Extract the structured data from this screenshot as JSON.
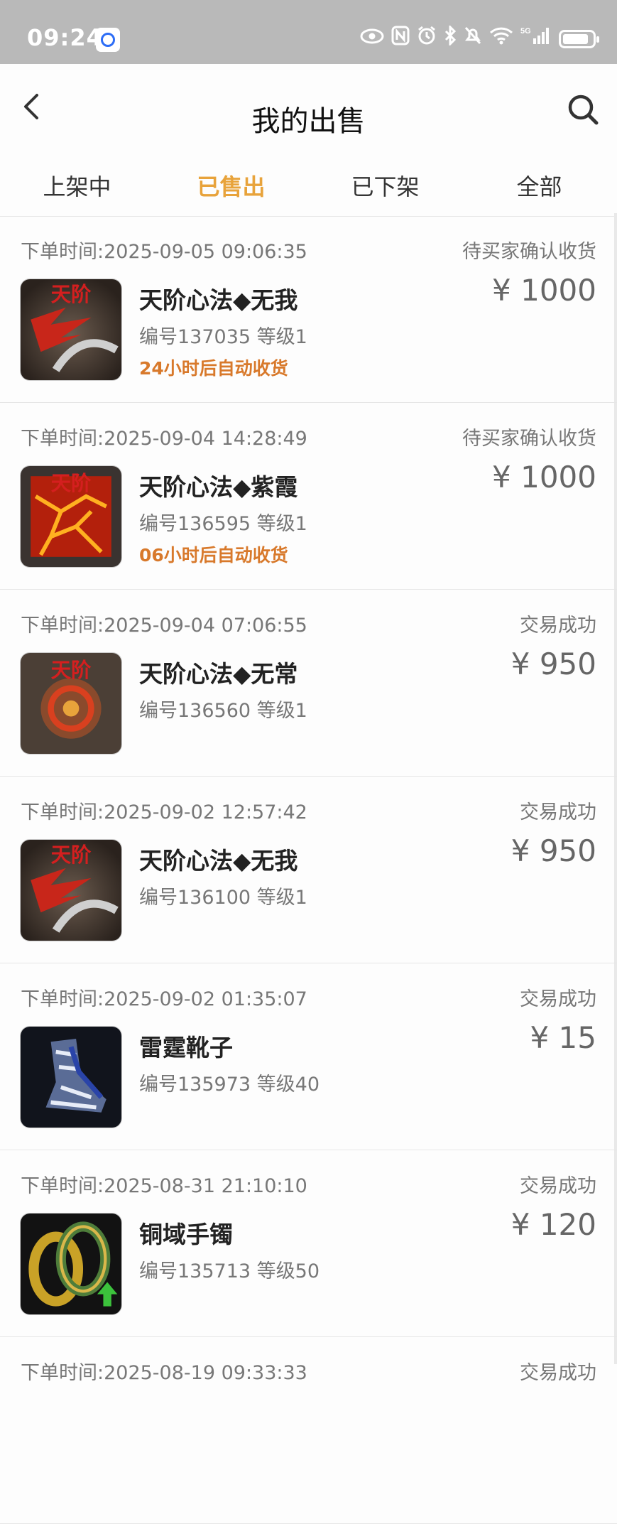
{
  "status_bar": {
    "time": "09:24",
    "icons": [
      "eye-icon",
      "nfc-icon",
      "alarm-icon",
      "bluetooth-icon",
      "mute-icon",
      "wifi-icon",
      "signal-5g-icon",
      "battery-icon"
    ]
  },
  "header": {
    "title": "我的出售",
    "back_icon": "chevron-left-icon",
    "search_icon": "search-icon"
  },
  "tabs": [
    {
      "label": "上架中",
      "active": false
    },
    {
      "label": "已售出",
      "active": true
    },
    {
      "label": "已下架",
      "active": false
    },
    {
      "label": "全部",
      "active": false
    }
  ],
  "accent_color": "#e8a33b",
  "auto_receive_color": "#d8792b",
  "orders": [
    {
      "time": "下单时间:2025-09-05 09:06:35",
      "status": "待买家确认收货",
      "name": "天阶心法◆无我",
      "meta": "编号137035 等级1",
      "auto": "24小时后自动收货",
      "price": "¥ 1000",
      "icon": "skill-wuwo-icon"
    },
    {
      "time": "下单时间:2025-09-04 14:28:49",
      "status": "待买家确认收货",
      "name": "天阶心法◆紫霞",
      "meta": "编号136595 等级1",
      "auto": "06小时后自动收货",
      "price": "¥ 1000",
      "icon": "skill-zixia-icon"
    },
    {
      "time": "下单时间:2025-09-04 07:06:55",
      "status": "交易成功",
      "name": "天阶心法◆无常",
      "meta": "编号136560 等级1",
      "auto": "",
      "price": "¥ 950",
      "icon": "skill-wuchang-icon"
    },
    {
      "time": "下单时间:2025-09-02 12:57:42",
      "status": "交易成功",
      "name": "天阶心法◆无我",
      "meta": "编号136100 等级1",
      "auto": "",
      "price": "¥ 950",
      "icon": "skill-wuwo-icon"
    },
    {
      "time": "下单时间:2025-09-02 01:35:07",
      "status": "交易成功",
      "name": "雷霆靴子",
      "meta": "编号135973 等级40",
      "auto": "",
      "price": "¥ 15",
      "icon": "boots-icon"
    },
    {
      "time": "下单时间:2025-08-31 21:10:10",
      "status": "交易成功",
      "name": "铜域手镯",
      "meta": "编号135713 等级50",
      "auto": "",
      "price": "¥ 120",
      "icon": "bracelet-icon"
    },
    {
      "time": "下单时间:2025-08-19 09:33:33",
      "status": "交易成功",
      "name": "",
      "meta": "",
      "auto": "",
      "price": "",
      "icon": ""
    }
  ],
  "icon_badge_text": "天阶"
}
